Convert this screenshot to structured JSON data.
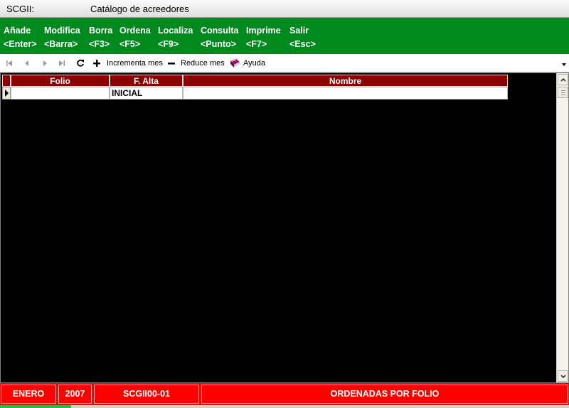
{
  "window": {
    "app": "SCGII:",
    "title": "Catálogo de acreedores"
  },
  "menu": [
    {
      "label": "Añade",
      "key": "<Enter>"
    },
    {
      "label": "Modifica",
      "key": "<Barra>"
    },
    {
      "label": "Borra",
      "key": "<F3>"
    },
    {
      "label": "Ordena",
      "key": "<F5>"
    },
    {
      "label": "Localiza",
      "key": "<F9>"
    },
    {
      "label": "Consulta",
      "key": "<Punto>"
    },
    {
      "label": "Imprime",
      "key": "<F7>"
    },
    {
      "label": "Salir",
      "key": "<Esc>"
    }
  ],
  "toolbar": {
    "increment_label": "Incrementa mes",
    "reduce_label": "Reduce mes",
    "help_label": "Ayuda"
  },
  "grid": {
    "columns": [
      "Folio",
      "F. Alta",
      "Nombre"
    ],
    "rows": [
      {
        "folio": "",
        "f_alta": "INICIAL",
        "nombre": ""
      }
    ]
  },
  "status": {
    "month": "ENERO",
    "year": "2007",
    "code": "SCGII00-01",
    "order": "ORDENADAS POR FOLIO"
  },
  "colors": {
    "menu_bg": "#008a1e",
    "header_bg": "#8b0000",
    "status_bg": "#ff0000"
  }
}
